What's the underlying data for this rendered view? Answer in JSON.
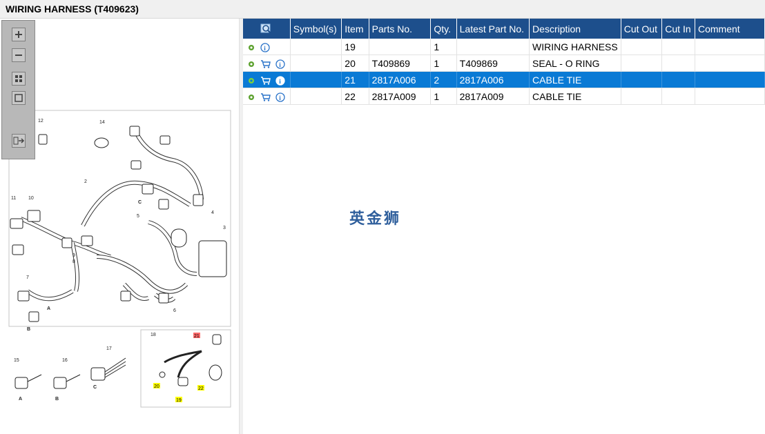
{
  "window": {
    "title": "WIRING HARNESS (T409623)"
  },
  "toolbar": {
    "buttons": [
      {
        "name": "zoom-in-icon"
      },
      {
        "name": "zoom-out-icon"
      },
      {
        "name": "fit-page-icon"
      },
      {
        "name": "actual-size-icon"
      },
      {
        "name": "export-icon"
      }
    ]
  },
  "diagram": {
    "labels": {
      "n12": "12",
      "n14": "14",
      "n2": "2",
      "n11": "11",
      "n10": "10",
      "n4": "4",
      "n3": "3",
      "n5": "5",
      "n9": "9",
      "n8": "8",
      "n7": "7",
      "n6": "6",
      "n15": "15",
      "n16": "16",
      "n17": "17",
      "n18": "18",
      "A1": "A",
      "B1": "B",
      "C1": "C",
      "A2": "A",
      "B2": "B",
      "C2": "C",
      "h21": "21",
      "h20": "20",
      "h19": "19",
      "h22": "22"
    }
  },
  "table": {
    "headers": {
      "search_icon": "search-icon",
      "symbol": "Symbol(s)",
      "item": "Item",
      "parts_no": "Parts No.",
      "qty": "Qty.",
      "latest": "Latest Part No.",
      "description": "Description",
      "cut_out": "Cut Out",
      "cut_in": "Cut In",
      "comment": "Comment"
    },
    "rows": [
      {
        "item": "19",
        "parts_no": "",
        "qty": "1",
        "latest": "",
        "description": "WIRING HARNESS",
        "cut_out": "",
        "cut_in": "",
        "comment": "",
        "cart": false,
        "selected": false
      },
      {
        "item": "20",
        "parts_no": "T409869",
        "qty": "1",
        "latest": "T409869",
        "description": "SEAL - O RING",
        "cut_out": "",
        "cut_in": "",
        "comment": "",
        "cart": true,
        "selected": false
      },
      {
        "item": "21",
        "parts_no": "2817A006",
        "qty": "2",
        "latest": "2817A006",
        "description": "CABLE TIE",
        "cut_out": "",
        "cut_in": "",
        "comment": "",
        "cart": true,
        "selected": true
      },
      {
        "item": "22",
        "parts_no": "2817A009",
        "qty": "1",
        "latest": "2817A009",
        "description": "CABLE TIE",
        "cut_out": "",
        "cut_in": "",
        "comment": "",
        "cart": true,
        "selected": false
      }
    ]
  },
  "watermark": "英金狮",
  "colors": {
    "header_bg": "#1d4f8c",
    "selected_row": "#0a7ad5",
    "highlight_yellow": "#ffff00",
    "highlight_red": "#ff6b6b"
  }
}
